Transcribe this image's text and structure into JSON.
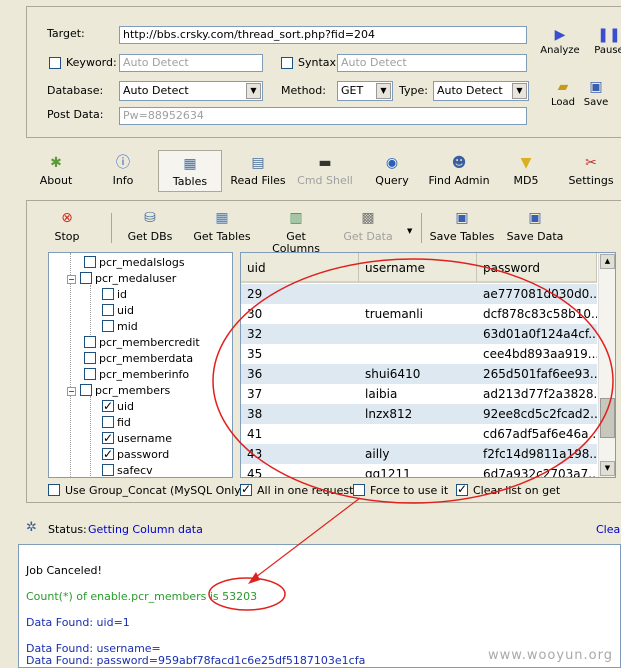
{
  "top": {
    "target_label": "Target:",
    "target_value": "http://bbs.crsky.com/thread_sort.php?fid=204",
    "keyword_label": "Keyword:",
    "keyword_placeholder": "Auto Detect",
    "syntax_label": "Syntax:",
    "syntax_placeholder": "Auto Detect",
    "database_label": "Database:",
    "database_value": "Auto Detect",
    "method_label": "Method:",
    "method_value": "GET",
    "type_label": "Type:",
    "type_value": "Auto Detect",
    "postdata_label": "Post Data:",
    "postdata_value": "Pw=88952634",
    "analyze_label": "Analyze",
    "pause_label": "Pause",
    "load_label": "Load",
    "save_label": "Save"
  },
  "toolbar": {
    "items": [
      {
        "label": "About",
        "icon": "gear-star-icon"
      },
      {
        "label": "Info",
        "icon": "info-icon"
      },
      {
        "label": "Tables",
        "icon": "table-icon"
      },
      {
        "label": "Read Files",
        "icon": "file-icon"
      },
      {
        "label": "Cmd Shell",
        "icon": "terminal-icon"
      },
      {
        "label": "Query",
        "icon": "query-icon"
      },
      {
        "label": "Find Admin",
        "icon": "users-icon"
      },
      {
        "label": "MD5",
        "icon": "funnel-icon"
      },
      {
        "label": "Settings",
        "icon": "tools-icon"
      }
    ]
  },
  "subtoolbar": {
    "stop_label": "Stop",
    "get_dbs_label": "Get DBs",
    "get_tables_label": "Get Tables",
    "get_columns_label": "Get Columns",
    "get_data_label": "Get Data",
    "save_tables_label": "Save Tables",
    "save_data_label": "Save Data"
  },
  "tree": {
    "nodes": [
      {
        "label": "pcr_medalslogs",
        "checked": false
      },
      {
        "label": "pcr_medaluser",
        "checked": false
      },
      {
        "label": "id",
        "checked": false
      },
      {
        "label": "uid",
        "checked": false
      },
      {
        "label": "mid",
        "checked": false
      },
      {
        "label": "pcr_membercredit",
        "checked": false
      },
      {
        "label": "pcr_memberdata",
        "checked": false
      },
      {
        "label": "pcr_memberinfo",
        "checked": false
      },
      {
        "label": "pcr_members",
        "checked": false
      },
      {
        "label": "uid",
        "checked": true
      },
      {
        "label": "fid",
        "checked": false
      },
      {
        "label": "username",
        "checked": true
      },
      {
        "label": "password",
        "checked": true
      },
      {
        "label": "safecv",
        "checked": false
      }
    ]
  },
  "grid": {
    "headers": [
      "uid",
      "username",
      "password"
    ],
    "rows": [
      {
        "uid": "29",
        "username": "",
        "password": "ae777081d030d0..."
      },
      {
        "uid": "30",
        "username": "truemanli",
        "password": "dcf878c83c58b10..."
      },
      {
        "uid": "32",
        "username": "",
        "password": "63d01a0f124a4cf..."
      },
      {
        "uid": "35",
        "username": "",
        "password": "cee4bd893aa919..."
      },
      {
        "uid": "36",
        "username": "shui6410",
        "password": "265d501faf6ee93..."
      },
      {
        "uid": "37",
        "username": "laibia",
        "password": "ad213d77f2a3828..."
      },
      {
        "uid": "38",
        "username": "lnzx812",
        "password": "92ee8cd5c2fcad2..."
      },
      {
        "uid": "41",
        "username": "",
        "password": "cd67adf5af6e46a..."
      },
      {
        "uid": "43",
        "username": "ailly",
        "password": "f2fc14d9811a198..."
      },
      {
        "uid": "45",
        "username": "gg1211",
        "password": "6d7a932c2703a7..."
      }
    ]
  },
  "options": {
    "group_concat_label": "Use Group_Concat (MySQL Only)",
    "all_in_one_label": "All in one request",
    "force_label": "Force to use it",
    "clear_list_label": "Clear list on get"
  },
  "status": {
    "label": "Status:",
    "value": "Getting Column data",
    "clear_label": "Clear"
  },
  "log": {
    "lines": [
      {
        "text": "Job Canceled!",
        "color": "black"
      },
      {
        "text": "Count(*) of enable.pcr_members is 53203",
        "color": "green"
      },
      {
        "text": "Data Found: uid=1",
        "color": "blue"
      },
      {
        "text": "Data Found: username=",
        "color": "blue"
      },
      {
        "text": "Data Found: password=959abf78facd1c6e25df5187103e1cfa",
        "color": "blue"
      }
    ]
  },
  "watermark": "www.wooyun.org",
  "colors": {
    "annotation": "#e0201c",
    "link": "#0000cc",
    "row_alt": "#dde8f0"
  }
}
